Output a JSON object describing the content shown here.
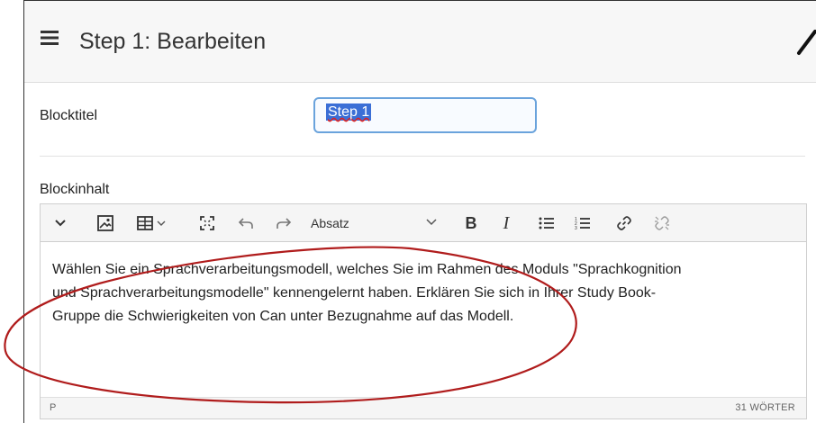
{
  "header": {
    "title": "Step 1: Bearbeiten",
    "menu_icon": "hamburger-icon",
    "edit_icon": "pencil-icon"
  },
  "form": {
    "block_title_label": "Blocktitel",
    "block_title_value": "Step 1",
    "block_content_label": "Blockinhalt"
  },
  "editor": {
    "toolbar": {
      "format_value": "Absatz",
      "bold_label": "B",
      "italic_label": "I",
      "icons": [
        "chevron-down-icon",
        "image-icon",
        "table-icon",
        "fullscreen-icon",
        "undo-icon",
        "redo-icon",
        "bullet-list-icon",
        "numbered-list-icon",
        "link-icon",
        "unlink-icon"
      ]
    },
    "content_lines": [
      "Wählen Sie ein Sprachverarbeitungsmodell, welches Sie im Rahmen des Moduls \"Sprachkognition",
      "und Sprachverarbeitungsmodelle\" kennengelernt haben. Erklären Sie sich in Ihrer Study Book-",
      "Gruppe die Schwierigkeiten von Can unter Bezugnahme auf das Modell."
    ],
    "status_path": "P",
    "word_count": "31 WÖRTER"
  },
  "colors": {
    "annotation_ellipse": "#b01c1c",
    "input_border": "#6aa3dc",
    "selection": "#3b6fd6"
  }
}
